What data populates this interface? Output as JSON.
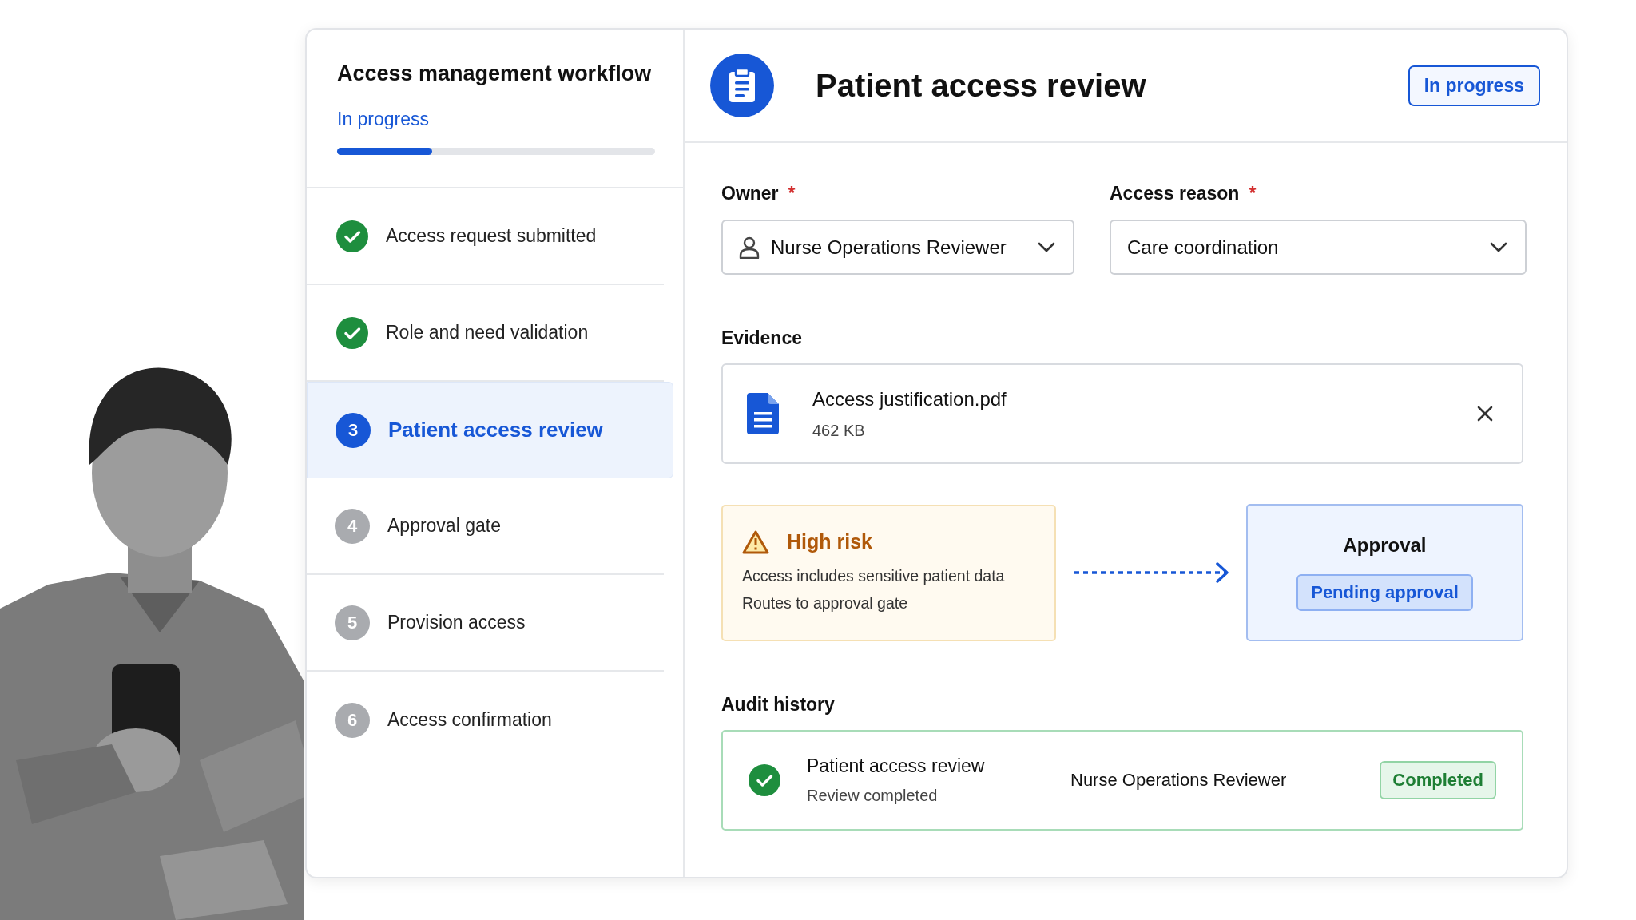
{
  "sidebar": {
    "title": "Access management workflow",
    "status": "In progress",
    "progress": {
      "level": 0.3
    },
    "steps": [
      {
        "label": "Access request submitted",
        "completed": true,
        "selected": false
      },
      {
        "label": "Role and need validation",
        "completed": true,
        "selected": false
      },
      {
        "number": "3",
        "label": "Patient access review",
        "completed": false,
        "selected": true
      },
      {
        "number": "4",
        "label": "Approval gate",
        "completed": false,
        "selected": false
      },
      {
        "number": "5",
        "label": "Provision access",
        "completed": false,
        "selected": false
      },
      {
        "number": "6",
        "label": "Access confirmation",
        "completed": false,
        "selected": false
      }
    ]
  },
  "header": {
    "title": "Patient access review",
    "badge": "In progress"
  },
  "fields": [
    {
      "label": "Owner",
      "required_mark": "*",
      "value": "Nurse Operations Reviewer",
      "kind": "person"
    },
    {
      "label": "Access reason",
      "required_mark": "*",
      "value": "Care coordination",
      "kind": "plain"
    }
  ],
  "evidence": {
    "label": "Evidence",
    "file": {
      "name": "Access justification.pdf",
      "size": "462 KB"
    }
  },
  "risk": {
    "title": "High risk",
    "lines": [
      "Access includes sensitive patient data",
      "Routes to approval gate"
    ]
  },
  "approval": {
    "title": "Approval",
    "badge": "Pending approval"
  },
  "audit": {
    "label": "Audit history",
    "entries": [
      {
        "title": "Patient access review",
        "subtitle": "Review completed",
        "actor": "Nurse Operations Reviewer",
        "status": "Completed"
      }
    ]
  }
}
